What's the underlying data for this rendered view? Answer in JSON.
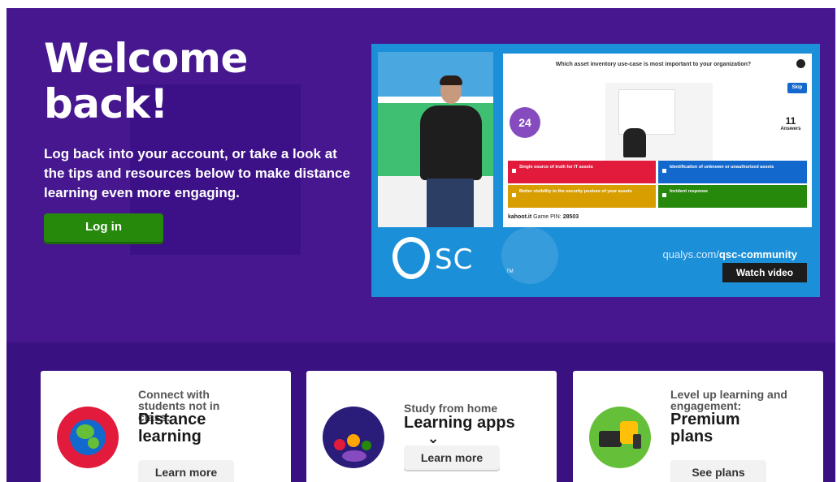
{
  "hero": {
    "title": "Welcome back!",
    "subtitle": "Log back into your account, or take a look at the tips and resources below to make distance learning even more engaging.",
    "login_label": "Log in"
  },
  "video": {
    "question": "Which asset inventory use-case is most important to your organization?",
    "skip_label": "Skip",
    "timer": "24",
    "answers_count": "11",
    "answers_label": "Answers",
    "options": [
      "Single source of truth for IT assets",
      "Identification of unknown or unauthorized assets",
      "Better visibility in the security posture of your assets",
      "Incident response"
    ],
    "pin_prefix": "kahoot.it",
    "pin_label": "Game PIN:",
    "pin": "28503",
    "brand_logo_text": "SC",
    "trademark": "TM",
    "url_prefix": "qualys.com/",
    "url_suffix": "qsc-community",
    "watch_label": "Watch video"
  },
  "cards": [
    {
      "kicker": "Connect with students not in class:",
      "title": "Distance learning",
      "button": "Learn more"
    },
    {
      "kicker": "Study from home",
      "title": "Learning apps",
      "button": "Learn more"
    },
    {
      "kicker": "Level up learning and engagement:",
      "title": "Premium plans",
      "button": "See plans"
    }
  ],
  "scroll_icon": "chevron-down-icon",
  "colors": {
    "background": "#46178f",
    "band": "#3a1180",
    "login_button": "#26890c",
    "answer_red": "#e21b3c",
    "answer_blue": "#1368ce",
    "answer_yellow": "#d89e00",
    "answer_green": "#26890c"
  }
}
